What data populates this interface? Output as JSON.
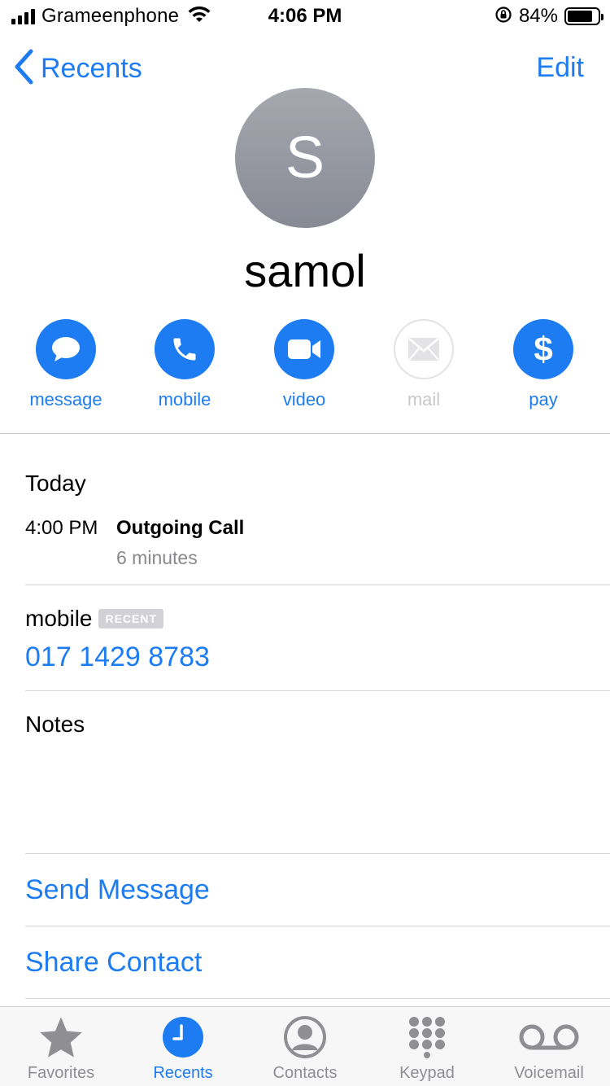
{
  "status_bar": {
    "carrier": "Grameenphone",
    "time": "4:06 PM",
    "battery_percent": "84%",
    "battery_level": 0.84,
    "signal_icon": "signal-bars-icon",
    "wifi_icon": "wifi-icon",
    "orientation_lock_icon": "orientation-lock-icon"
  },
  "nav": {
    "back_label": "Recents",
    "edit_label": "Edit"
  },
  "contact": {
    "initial": "S",
    "name": "samol"
  },
  "actions": [
    {
      "label": "message",
      "icon": "message-bubble-icon",
      "enabled": true
    },
    {
      "label": "mobile",
      "icon": "phone-icon",
      "enabled": true
    },
    {
      "label": "video",
      "icon": "video-camera-icon",
      "enabled": true
    },
    {
      "label": "mail",
      "icon": "envelope-icon",
      "enabled": false
    },
    {
      "label": "pay",
      "icon": "dollar-icon",
      "enabled": true
    }
  ],
  "recent_calls": {
    "day": "Today",
    "time": "4:00 PM",
    "type": "Outgoing Call",
    "duration": "6 minutes"
  },
  "phone": {
    "label": "mobile",
    "badge": "RECENT",
    "number": "017 1429 8783"
  },
  "notes": {
    "label": "Notes"
  },
  "links": {
    "send_message": "Send Message",
    "share_contact": "Share Contact"
  },
  "tab_bar": {
    "active": "Recents",
    "accent": "#1d7cf2",
    "tabs": [
      {
        "label": "Favorites",
        "icon": "star-icon"
      },
      {
        "label": "Recents",
        "icon": "clock-icon"
      },
      {
        "label": "Contacts",
        "icon": "person-circle-icon"
      },
      {
        "label": "Keypad",
        "icon": "keypad-icon"
      },
      {
        "label": "Voicemail",
        "icon": "voicemail-icon"
      }
    ]
  }
}
